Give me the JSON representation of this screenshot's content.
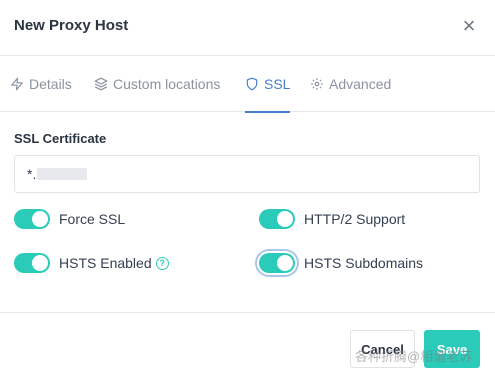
{
  "modal": {
    "title": "New Proxy Host",
    "close_label": "×"
  },
  "tabs": [
    {
      "label": "Details",
      "icon": "zap-icon",
      "active": false
    },
    {
      "label": "Custom locations",
      "icon": "layers-icon",
      "active": false
    },
    {
      "label": "SSL",
      "icon": "shield-icon",
      "active": true
    },
    {
      "label": "Advanced",
      "icon": "gear-icon",
      "active": false
    }
  ],
  "ssl": {
    "section_label": "SSL Certificate",
    "certificate_value": "*."
  },
  "toggles": {
    "force_ssl": {
      "label": "Force SSL",
      "on": true
    },
    "http2": {
      "label": "HTTP/2 Support",
      "on": true
    },
    "hsts_enabled": {
      "label": "HSTS Enabled",
      "on": true,
      "help": "?"
    },
    "hsts_subdomains": {
      "label": "HSTS Subdomains",
      "on": true
    }
  },
  "footer": {
    "cancel_label": "Cancel",
    "save_label": "Save"
  },
  "watermark": "各种折腾@相谐老苏",
  "colors": {
    "accent": "#2bcbba",
    "tab_active": "#467fcf"
  }
}
